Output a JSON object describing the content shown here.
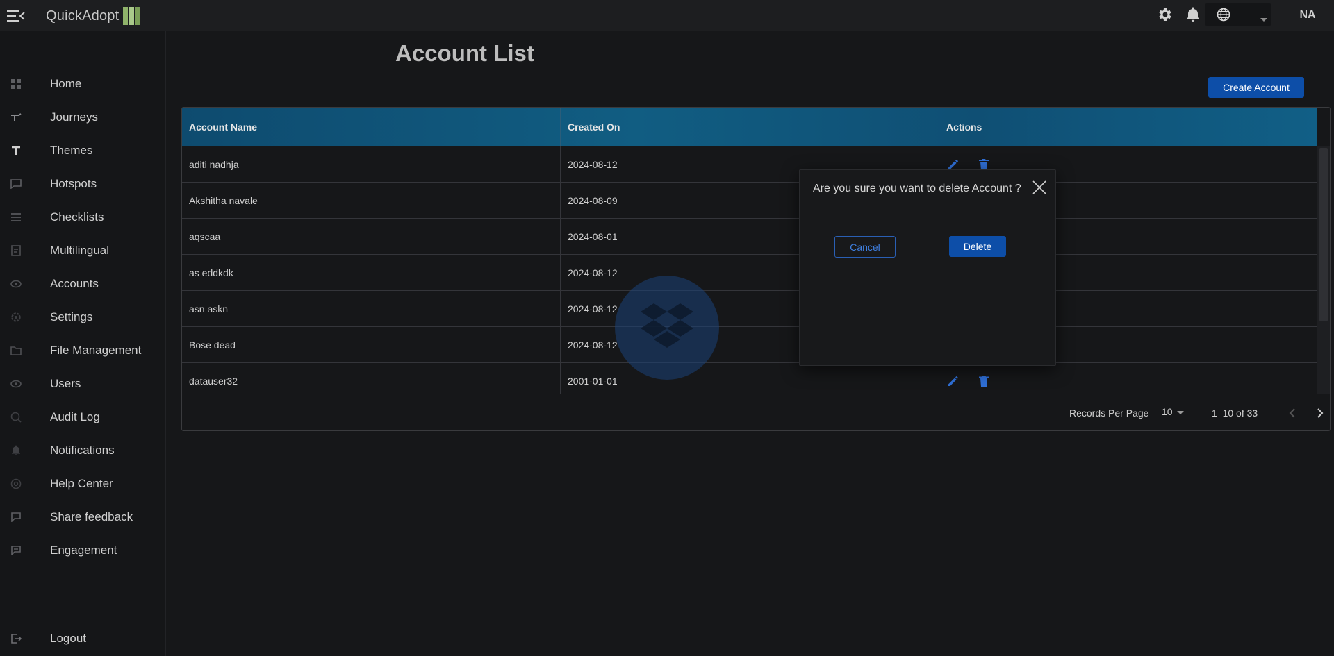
{
  "app": {
    "name": "QuickAdopt",
    "user_initials": "NA",
    "accent_color": "#0d4ea8"
  },
  "sidebar": {
    "items": [
      {
        "label": "Home",
        "icon": "grid-icon"
      },
      {
        "label": "Journeys",
        "icon": "journey-icon"
      },
      {
        "label": "Themes",
        "icon": "text-icon"
      },
      {
        "label": "Hotspots",
        "icon": "chat-icon"
      },
      {
        "label": "Checklists",
        "icon": "checklist-icon"
      },
      {
        "label": "Multilingual",
        "icon": "translate-icon"
      },
      {
        "label": "Accounts",
        "icon": "accounts-icon"
      },
      {
        "label": "Settings",
        "icon": "gear-icon"
      },
      {
        "label": "File Management",
        "icon": "folder-icon"
      },
      {
        "label": "Users",
        "icon": "users-icon"
      },
      {
        "label": "Audit Log",
        "icon": "audit-icon"
      },
      {
        "label": "Notifications",
        "icon": "bell-icon"
      },
      {
        "label": "Help Center",
        "icon": "help-icon"
      },
      {
        "label": "Share feedback",
        "icon": "feedback-icon"
      },
      {
        "label": "Engagement",
        "icon": "engagement-icon"
      }
    ],
    "logout_label": "Logout"
  },
  "main": {
    "title": "Account List",
    "create_button": "Create Account",
    "table": {
      "columns": [
        "Account Name",
        "Created On",
        "Actions"
      ],
      "rows": [
        {
          "name": "aditi nadhja",
          "created": "2024-08-12"
        },
        {
          "name": "Akshitha navale",
          "created": "2024-08-09"
        },
        {
          "name": "aqscaa",
          "created": "2024-08-01"
        },
        {
          "name": "as eddkdk",
          "created": "2024-08-12"
        },
        {
          "name": "asn askn",
          "created": "2024-08-12"
        },
        {
          "name": "Bose dead",
          "created": "2024-08-12"
        },
        {
          "name": "datauser32",
          "created": "2001-01-01"
        }
      ]
    },
    "pagination": {
      "records_per_page_label": "Records Per Page",
      "records_per_page": "10",
      "range": "1–10 of 33"
    }
  },
  "dialog": {
    "message": "Are you sure you want to delete Account ?",
    "cancel_label": "Cancel",
    "delete_label": "Delete"
  }
}
